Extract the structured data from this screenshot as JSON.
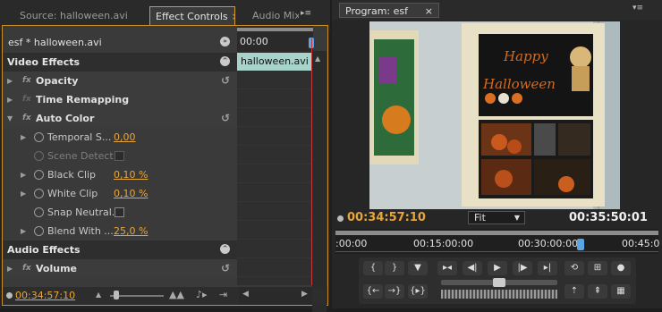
{
  "left_panel": {
    "tabs": [
      {
        "label": "Source: halloween.avi"
      },
      {
        "label": "Effect Controls",
        "active": true
      },
      {
        "label": "Audio Mix"
      }
    ],
    "clip_header": "esf * halloween.avi",
    "timeline_time": "00:00",
    "clip_bar_label": "halloween.avi",
    "video_effects_label": "Video Effects",
    "audio_effects_label": "Audio Effects",
    "effects": {
      "opacity": "Opacity",
      "time_remapping": "Time Remapping",
      "auto_color": "Auto Color",
      "volume": "Volume"
    },
    "params": {
      "temporal_smoothing": {
        "label": "Temporal S...",
        "value": "0,00"
      },
      "scene_detect": {
        "label": "Scene Detect"
      },
      "black_clip": {
        "label": "Black Clip",
        "value": "0,10 %"
      },
      "white_clip": {
        "label": "White Clip",
        "value": "0,10 %"
      },
      "snap_neutral": {
        "label": "Snap Neutral..."
      },
      "blend_with": {
        "label": "Blend With ...",
        "value": "25,0 %"
      }
    },
    "current_time": "00:34:57:10"
  },
  "right_panel": {
    "tab_label": "Program: esf",
    "current_time": "00:34:57:10",
    "fit_label": "Fit",
    "duration": "00:35:50:01",
    "ruler_labels": [
      ":00:00",
      "00:15:00:00",
      "00:30:00:00",
      "00:45:0"
    ],
    "poster_text": [
      "Happy",
      "Halloween"
    ]
  },
  "colors": {
    "accent_orange": "#e8a53a",
    "panel_dark": "#232323",
    "clip_bar": "#a7d3cb",
    "playhead_red": "#c23a3a",
    "playhead_blue": "#5aa5e6"
  }
}
